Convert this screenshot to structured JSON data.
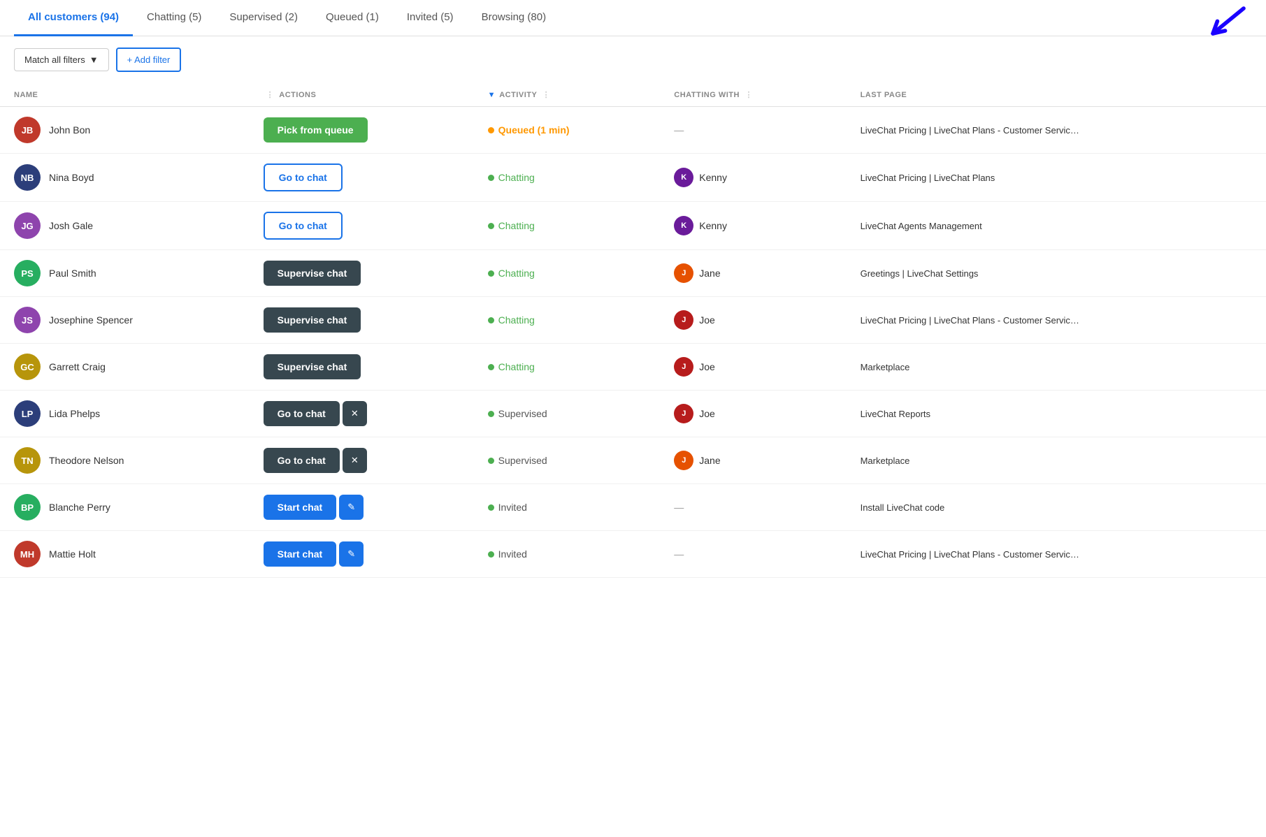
{
  "tabs": [
    {
      "id": "all",
      "label": "All customers",
      "count": 94,
      "active": true
    },
    {
      "id": "chatting",
      "label": "Chatting",
      "count": 5,
      "active": false
    },
    {
      "id": "supervised",
      "label": "Supervised",
      "count": 2,
      "active": false
    },
    {
      "id": "queued",
      "label": "Queued",
      "count": 1,
      "active": false
    },
    {
      "id": "invited",
      "label": "Invited",
      "count": 5,
      "active": false
    },
    {
      "id": "browsing",
      "label": "Browsing",
      "count": 80,
      "active": false
    }
  ],
  "filters": {
    "match_all_label": "Match all filters",
    "add_filter_label": "+ Add filter"
  },
  "columns": {
    "name": "NAME",
    "actions": "ACTIONS",
    "activity": "ACTIVITY",
    "chatting_with": "CHATTING WITH",
    "last_page": "LAST PAGE"
  },
  "rows": [
    {
      "initials": "JB",
      "name": "John Bon",
      "avatar_color": "#c0392b",
      "action_type": "pick_queue",
      "action_label": "Pick from queue",
      "activity_type": "queued",
      "activity_label": "Queued (1 min)",
      "chatting_with": "—",
      "agent_name": "",
      "agent_type": "",
      "last_page": "LiveChat Pricing | LiveChat Plans - Customer Servic…"
    },
    {
      "initials": "NB",
      "name": "Nina Boyd",
      "avatar_color": "#2c3e7a",
      "action_type": "go_chat_outline",
      "action_label": "Go to chat",
      "activity_type": "chatting",
      "activity_label": "Chatting",
      "chatting_with": "Kenny",
      "agent_name": "Kenny",
      "agent_type": "kenny",
      "last_page": "LiveChat Pricing | LiveChat Plans"
    },
    {
      "initials": "JG",
      "name": "Josh Gale",
      "avatar_color": "#8e44ad",
      "action_type": "go_chat_outline",
      "action_label": "Go to chat",
      "activity_type": "chatting",
      "activity_label": "Chatting",
      "chatting_with": "Kenny",
      "agent_name": "Kenny",
      "agent_type": "kenny",
      "last_page": "LiveChat Agents Management"
    },
    {
      "initials": "PS",
      "name": "Paul Smith",
      "avatar_color": "#27ae60",
      "action_type": "supervise",
      "action_label": "Supervise chat",
      "activity_type": "chatting",
      "activity_label": "Chatting",
      "chatting_with": "Jane",
      "agent_name": "Jane",
      "agent_type": "jane",
      "last_page": "Greetings | LiveChat Settings"
    },
    {
      "initials": "JS",
      "name": "Josephine Spencer",
      "avatar_color": "#8e44ad",
      "action_type": "supervise",
      "action_label": "Supervise chat",
      "activity_type": "chatting",
      "activity_label": "Chatting",
      "chatting_with": "Joe",
      "agent_name": "Joe",
      "agent_type": "joe",
      "last_page": "LiveChat Pricing | LiveChat Plans - Customer Servic…"
    },
    {
      "initials": "GC",
      "name": "Garrett Craig",
      "avatar_color": "#b7950b",
      "action_type": "supervise",
      "action_label": "Supervise chat",
      "activity_type": "chatting",
      "activity_label": "Chatting",
      "chatting_with": "Joe",
      "agent_name": "Joe",
      "agent_type": "joe",
      "last_page": "Marketplace"
    },
    {
      "initials": "LP",
      "name": "Lida Phelps",
      "avatar_color": "#2c3e7a",
      "action_type": "go_chat_dark",
      "action_label": "Go to chat",
      "action_secondary": "×",
      "activity_type": "supervised",
      "activity_label": "Supervised",
      "chatting_with": "Joe",
      "agent_name": "Joe",
      "agent_type": "joe",
      "last_page": "LiveChat Reports"
    },
    {
      "initials": "TN",
      "name": "Theodore Nelson",
      "avatar_color": "#b7950b",
      "action_type": "go_chat_dark",
      "action_label": "Go to chat",
      "action_secondary": "×",
      "activity_type": "supervised",
      "activity_label": "Supervised",
      "chatting_with": "Jane",
      "agent_name": "Jane",
      "agent_type": "jane",
      "last_page": "Marketplace"
    },
    {
      "initials": "BP",
      "name": "Blanche Perry",
      "avatar_color": "#27ae60",
      "action_type": "start_chat",
      "action_label": "Start chat",
      "action_secondary": "✎",
      "activity_type": "invited",
      "activity_label": "Invited",
      "chatting_with": "—",
      "agent_name": "",
      "agent_type": "",
      "last_page": "Install LiveChat code"
    },
    {
      "initials": "MH",
      "name": "Mattie Holt",
      "avatar_color": "#c0392b",
      "action_type": "start_chat",
      "action_label": "Start chat",
      "action_secondary": "✎",
      "activity_type": "invited",
      "activity_label": "Invited",
      "chatting_with": "—",
      "agent_name": "",
      "agent_type": "",
      "last_page": "LiveChat Pricing | LiveChat Plans - Customer Servic…"
    }
  ],
  "colors": {
    "blue": "#1a73e8",
    "green": "#4caf50",
    "dark": "#37474f",
    "orange": "#ff9800"
  }
}
